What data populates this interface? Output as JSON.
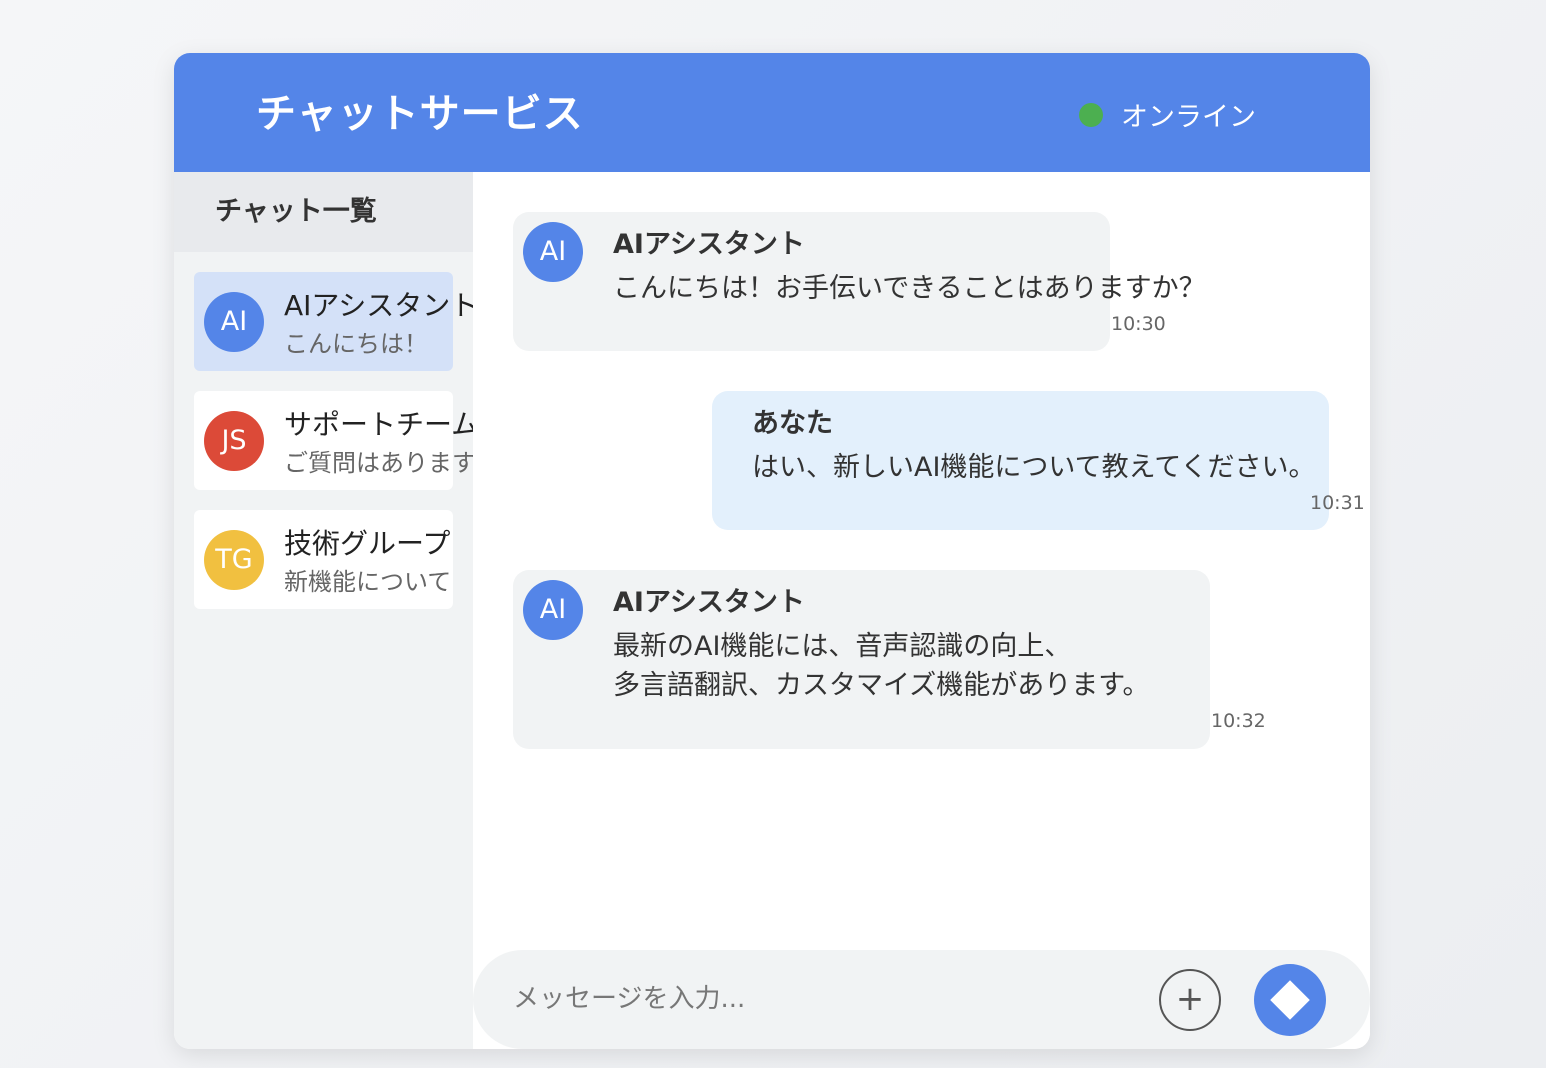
{
  "header": {
    "title": "チャットサービス",
    "status": "オンライン",
    "status_color": "#4caf50",
    "accent": "#5485e8"
  },
  "sidebar": {
    "title": "チャット一覧",
    "items": [
      {
        "initials": "AI",
        "name": "AIアシスタント",
        "preview": "こんにちは！",
        "color": "#5485e8",
        "active": true
      },
      {
        "initials": "JS",
        "name": "サポートチーム",
        "preview": "ご質問はあります",
        "color": "#dc4a38",
        "active": false
      },
      {
        "initials": "TG",
        "name": "技術グループ",
        "preview": "新機能について",
        "color": "#f1c040",
        "active": false
      }
    ]
  },
  "messages": [
    {
      "avatar": "AI",
      "sender": "AIアシスタント",
      "lines": [
        "こんにちは！お手伝いできることはありますか？"
      ],
      "time": "10:30",
      "mine": false
    },
    {
      "sender": "あなた",
      "lines": [
        "はい、新しいAI機能について教えてください。"
      ],
      "time": "10:31",
      "mine": true
    },
    {
      "avatar": "AI",
      "sender": "AIアシスタント",
      "lines": [
        "最新のAI機能には、音声認識の向上、",
        "多言語翻訳、カスタマイズ機能があります。"
      ],
      "time": "10:32",
      "mine": false
    }
  ],
  "composer": {
    "placeholder": "メッセージを入力...",
    "add_icon": "plus-icon",
    "send_icon": "send-icon"
  }
}
